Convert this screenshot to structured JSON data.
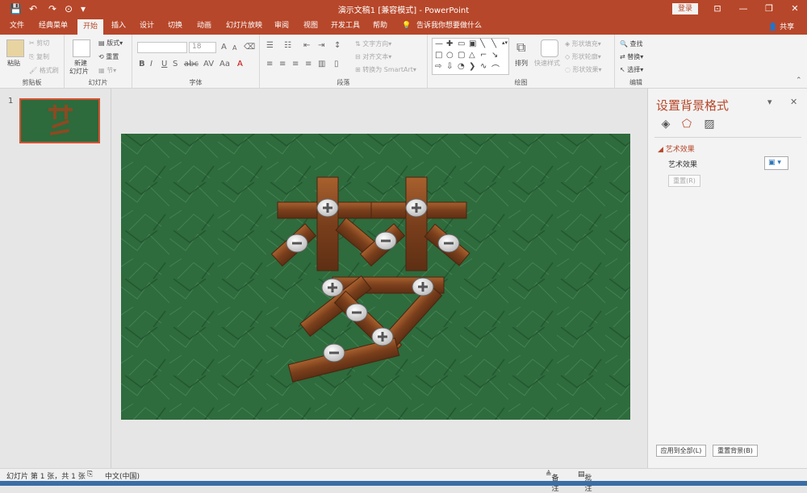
{
  "window": {
    "title": "演示文稿1 [兼容模式] - PowerPoint",
    "login_label": "登录",
    "controls": [
      "⊡",
      "—",
      "❐",
      "✕"
    ]
  },
  "quick_access": [
    "💾",
    "↶",
    "↷",
    "⊙",
    "▾"
  ],
  "tabs": [
    "文件",
    "经典菜单",
    "开始",
    "插入",
    "设计",
    "切换",
    "动画",
    "幻灯片放映",
    "审阅",
    "视图",
    "开发工具",
    "帮助"
  ],
  "tell_me": "告诉我你想要做什么",
  "share_label": "共享",
  "ribbon": {
    "clipboard": {
      "paste": "粘贴",
      "cut": "剪切",
      "copy": "复制",
      "format_painter": "格式刷",
      "label": "剪贴板"
    },
    "slides": {
      "new_slide": "新建",
      "new_slide2": "幻灯片",
      "layout": "版式",
      "reset": "重置",
      "section": "节",
      "label": "幻灯片"
    },
    "font": {
      "size": "18",
      "label": "字体"
    },
    "paragraph": {
      "text_direction": "文字方向",
      "align_text": "对齐文本",
      "smartart": "转换为 SmartArt",
      "label": "段落"
    },
    "drawing": {
      "arrange": "排列",
      "quick_styles": "快速样式",
      "shape_fill": "形状填充",
      "shape_outline": "形状轮廓",
      "shape_effects": "形状效果",
      "label": "绘图"
    },
    "editing": {
      "find": "查找",
      "replace": "替换",
      "select": "选择",
      "label": "编辑"
    }
  },
  "slides_pane": {
    "number": "1"
  },
  "format_pane": {
    "title": "设置背景格式",
    "section": "艺术效果",
    "effect_label": "艺术效果",
    "reset_label": "重置(R)",
    "apply_all": "应用到全部(L)",
    "reset_background": "重置背景(B)"
  },
  "status_bar": {
    "slide_info": "幻灯片 第 1 张，共 1 张",
    "language": "中文(中国)",
    "notes": "备注",
    "comments": "批注"
  },
  "colors": {
    "accent": "#b7472a",
    "slide_bg": "#2d6a3c",
    "wood": "#8b4a22"
  }
}
